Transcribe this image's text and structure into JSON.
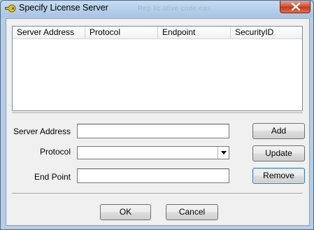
{
  "window": {
    "title": "Specify License Server",
    "ghost_title": "Rep lic ative code eas"
  },
  "listview": {
    "columns": [
      "Server Address",
      "Protocol",
      "Endpoint",
      "SecurityID"
    ],
    "rows": []
  },
  "form": {
    "server_address": {
      "label": "Server Address",
      "value": ""
    },
    "protocol": {
      "label": "Protocol",
      "value": ""
    },
    "end_point": {
      "label": "End Point",
      "value": ""
    }
  },
  "buttons": {
    "add": "Add",
    "update": "Update",
    "remove": "Remove",
    "ok": "OK",
    "cancel": "Cancel"
  },
  "icons": {
    "title": "key-icon",
    "close": "close-icon",
    "dropdown": "chevron-down-icon"
  },
  "colors": {
    "close_button": "#c84528",
    "focus_border": "#3c7fb1"
  }
}
